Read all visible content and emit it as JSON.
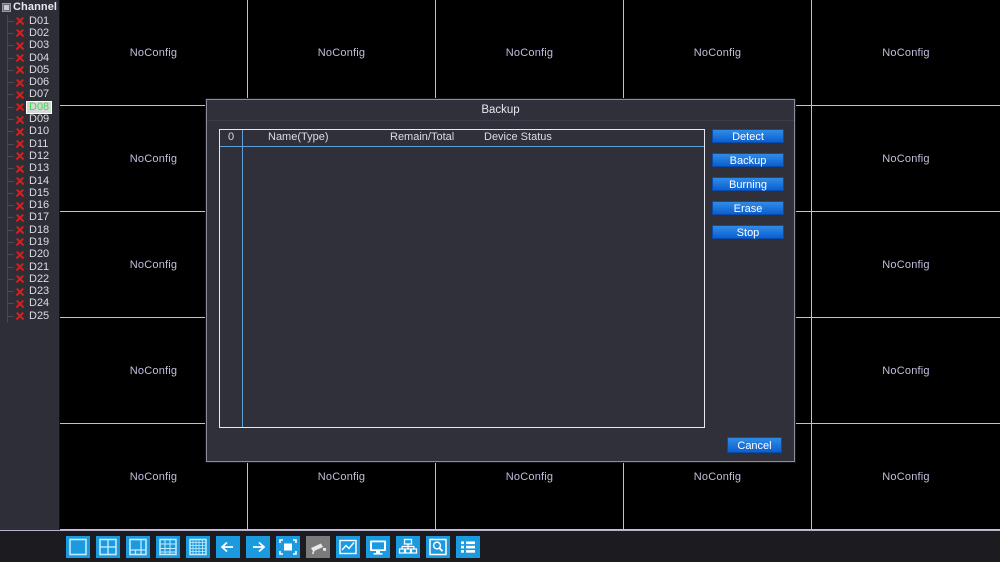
{
  "sidebar": {
    "header_label": "Channel",
    "header_icon": "expand-box-icon",
    "channels": [
      {
        "label": "D01",
        "status_icon": "red-x-icon",
        "selected": false
      },
      {
        "label": "D02",
        "status_icon": "red-x-icon",
        "selected": false
      },
      {
        "label": "D03",
        "status_icon": "red-x-icon",
        "selected": false
      },
      {
        "label": "D04",
        "status_icon": "red-x-icon",
        "selected": false
      },
      {
        "label": "D05",
        "status_icon": "red-x-icon",
        "selected": false
      },
      {
        "label": "D06",
        "status_icon": "red-x-icon",
        "selected": false
      },
      {
        "label": "D07",
        "status_icon": "red-x-icon",
        "selected": false
      },
      {
        "label": "D08",
        "status_icon": "red-x-icon",
        "selected": true
      },
      {
        "label": "D09",
        "status_icon": "red-x-icon",
        "selected": false
      },
      {
        "label": "D10",
        "status_icon": "red-x-icon",
        "selected": false
      },
      {
        "label": "D11",
        "status_icon": "red-x-icon",
        "selected": false
      },
      {
        "label": "D12",
        "status_icon": "red-x-icon",
        "selected": false
      },
      {
        "label": "D13",
        "status_icon": "red-x-icon",
        "selected": false
      },
      {
        "label": "D14",
        "status_icon": "red-x-icon",
        "selected": false
      },
      {
        "label": "D15",
        "status_icon": "red-x-icon",
        "selected": false
      },
      {
        "label": "D16",
        "status_icon": "red-x-icon",
        "selected": false
      },
      {
        "label": "D17",
        "status_icon": "red-x-icon",
        "selected": false
      },
      {
        "label": "D18",
        "status_icon": "red-x-icon",
        "selected": false
      },
      {
        "label": "D19",
        "status_icon": "red-x-icon",
        "selected": false
      },
      {
        "label": "D20",
        "status_icon": "red-x-icon",
        "selected": false
      },
      {
        "label": "D21",
        "status_icon": "red-x-icon",
        "selected": false
      },
      {
        "label": "D22",
        "status_icon": "red-x-icon",
        "selected": false
      },
      {
        "label": "D23",
        "status_icon": "red-x-icon",
        "selected": false
      },
      {
        "label": "D24",
        "status_icon": "red-x-icon",
        "selected": false
      },
      {
        "label": "D25",
        "status_icon": "red-x-icon",
        "selected": false
      }
    ]
  },
  "video_wall": {
    "columns": 5,
    "rows": 5,
    "pane_label": "NoConfig",
    "panes": [
      "NoConfig",
      "NoConfig",
      "NoConfig",
      "NoConfig",
      "NoConfig",
      "NoConfig",
      "NoConfig",
      "NoConfig",
      "NoConfig",
      "NoConfig",
      "NoConfig",
      "NoConfig",
      "NoConfig",
      "NoConfig",
      "NoConfig",
      "NoConfig",
      "NoConfig",
      "NoConfig",
      "NoConfig",
      "NoConfig",
      "NoConfig",
      "NoConfig",
      "NoConfig",
      "NoConfig",
      "NoConfig"
    ]
  },
  "dialog": {
    "title": "Backup",
    "table": {
      "headers": [
        "0",
        "Name(Type)",
        "Remain/Total",
        "Device Status"
      ],
      "rows": []
    },
    "buttons": [
      {
        "label": "Detect"
      },
      {
        "label": "Backup"
      },
      {
        "label": "Burning"
      },
      {
        "label": "Erase"
      },
      {
        "label": "Stop"
      }
    ],
    "cancel_label": "Cancel"
  },
  "toolbar": {
    "items": [
      {
        "name": "layout-1-icon",
        "state": "active"
      },
      {
        "name": "layout-4-icon",
        "state": "active"
      },
      {
        "name": "layout-6-icon",
        "state": "active"
      },
      {
        "name": "layout-9-icon",
        "state": "active"
      },
      {
        "name": "layout-16-icon",
        "state": "active"
      },
      {
        "name": "prev-page-icon",
        "state": "active"
      },
      {
        "name": "next-page-icon",
        "state": "active"
      },
      {
        "name": "pip-window-icon",
        "state": "active"
      },
      {
        "name": "camera-ptz-icon",
        "state": "disabled"
      },
      {
        "name": "playback-chart-icon",
        "state": "active"
      },
      {
        "name": "monitor-icon",
        "state": "active"
      },
      {
        "name": "network-tree-icon",
        "state": "active"
      },
      {
        "name": "disk-search-icon",
        "state": "active"
      },
      {
        "name": "main-menu-list-icon",
        "state": "active"
      }
    ]
  },
  "colors": {
    "accent_blue": "#1b9ae0",
    "button_blue": "#0c5fd0",
    "pane_border": "#c4bddc",
    "pane_text": "#c4bddc",
    "panel_bg": "#2e2e36",
    "status_red": "#d81f1f",
    "selected_green": "#3ddc50"
  }
}
